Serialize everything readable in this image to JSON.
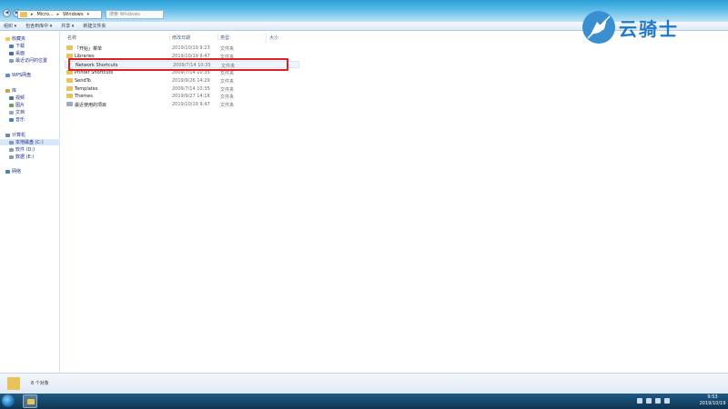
{
  "address": {
    "crumbs": [
      "Micro...",
      "Windows"
    ],
    "search_placeholder": "搜索 Windows"
  },
  "command_bar": {
    "items": [
      "组织 ▾",
      "包含到库中 ▾",
      "共享 ▾",
      "新建文件夹"
    ]
  },
  "nav_pane": {
    "favorites": [
      "收藏夹",
      "下载",
      "桌面",
      "最近访问的位置"
    ],
    "wps": "WPS网盘",
    "libraries": [
      "库",
      "视频",
      "图片",
      "文档",
      "音乐"
    ],
    "computer": [
      "计算机",
      "本地磁盘 (C:)",
      "软件 (D:)",
      "数据 (E:)"
    ],
    "network": "网络"
  },
  "columns": {
    "name": "名称",
    "date": "修改日期",
    "type": "类型",
    "size": "大小"
  },
  "files": [
    {
      "name": "「开始」菜单",
      "date": "2019/10/19 9:23",
      "type": "文件夹"
    },
    {
      "name": "Libraries",
      "date": "2019/10/19 9:47",
      "type": "文件夹"
    },
    {
      "name": "Network Shortcuts",
      "date": "2009/7/14 10:35",
      "type": "文件夹"
    },
    {
      "name": "Printer Shortcuts",
      "date": "2009/7/14 10:35",
      "type": "文件夹"
    },
    {
      "name": "SendTo",
      "date": "2019/9/26 14:29",
      "type": "文件夹"
    },
    {
      "name": "Templates",
      "date": "2009/7/14 10:35",
      "type": "文件夹"
    },
    {
      "name": "Themes",
      "date": "2019/9/27 14:18",
      "type": "文件夹"
    },
    {
      "name": "最近使用的项目",
      "date": "2019/10/19 9:47",
      "type": "文件夹"
    }
  ],
  "details": {
    "count_text": "8 个对象"
  },
  "watermark": {
    "text": "云骑士"
  },
  "taskbar": {
    "time": "9:53",
    "date": "2019/10/19"
  },
  "colors": {
    "highlight": "#e02020",
    "folder": "#e9c35a",
    "taskbar": "#1d5a85"
  },
  "icons": [
    "back-arrow-icon",
    "forward-arrow-icon",
    "folder-icon",
    "search-icon",
    "star-icon",
    "network-icon",
    "computer-icon",
    "drive-icon",
    "start-orb-icon"
  ]
}
